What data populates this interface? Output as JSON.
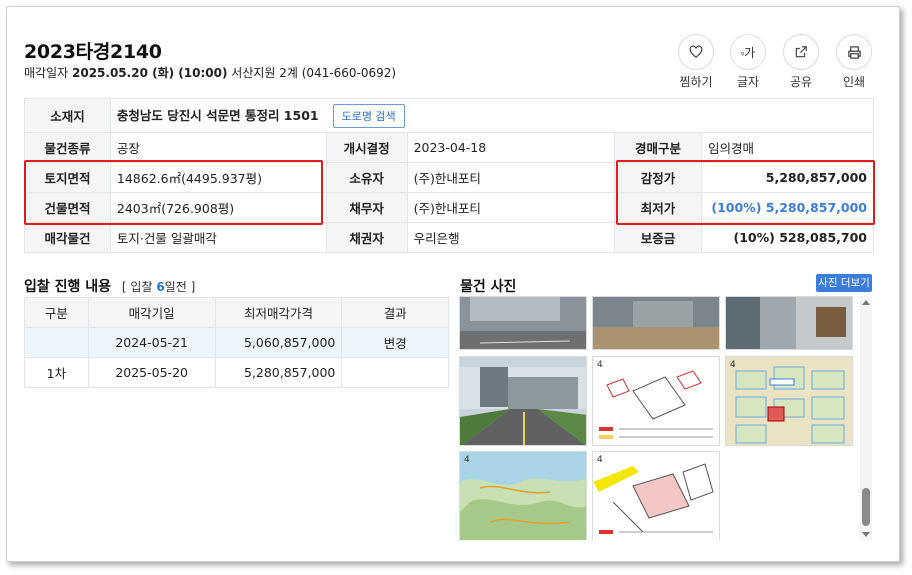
{
  "header": {
    "case_number": "2023타경2140",
    "sale_label": "매각일자",
    "sale_date": "2025.05.20 (화) (10:00)",
    "court": "서산지원 2계 (041-660-0692)"
  },
  "actions": [
    {
      "label": "찜하기",
      "icon": "heart-icon"
    },
    {
      "label": "글자",
      "icon": "font-size-icon",
      "glyph": "ᵍ가"
    },
    {
      "label": "공유",
      "icon": "share-icon"
    },
    {
      "label": "인쇄",
      "icon": "print-icon"
    }
  ],
  "info": {
    "location_label": "소재지",
    "location": "충청남도 당진시 석문면 통정리 1501",
    "road_search": "도로명 검색",
    "type_label": "물건종류",
    "type": "공장",
    "start_label": "개시결정",
    "start": "2023-04-18",
    "auction_kind_label": "경매구분",
    "auction_kind": "임의경매",
    "land_area_label": "토지면적",
    "land_area": "14862.6㎡(4495.937평)",
    "owner_label": "소유자",
    "owner": "(주)한내포티",
    "appraisal_label": "감정가",
    "appraisal": "5,280,857,000",
    "building_area_label": "건물면적",
    "building_area": "2403㎡(726.908평)",
    "debtor_label": "채무자",
    "debtor": "(주)한내포티",
    "min_price_label": "최저가",
    "min_price": "(100%) 5,280,857,000",
    "sale_object_label": "매각물건",
    "sale_object": "토지·건물 일괄매각",
    "creditor_label": "채권자",
    "creditor": "우리은행",
    "deposit_label": "보증금",
    "deposit": "(10%) 528,085,700"
  },
  "bid_section": {
    "title": "입찰 진행 내용",
    "sub_prefix": "[ 입찰",
    "days_left": "6",
    "sub_suffix": "일전 ]",
    "headers": [
      "구분",
      "매각기일",
      "최저매각가격",
      "결과"
    ],
    "rows": [
      {
        "round": "",
        "date": "2024-05-21",
        "price": "5,060,857,000",
        "result": "변경"
      },
      {
        "round": "1차",
        "date": "2025-05-20",
        "price": "5,280,857,000",
        "result": ""
      }
    ]
  },
  "photos": {
    "title": "물건 사진",
    "more": "사진 더보기"
  },
  "colors": {
    "accent_blue": "#3b7ddd",
    "highlight_red": "#e21b1b",
    "header_bg": "#f3f5f7"
  }
}
